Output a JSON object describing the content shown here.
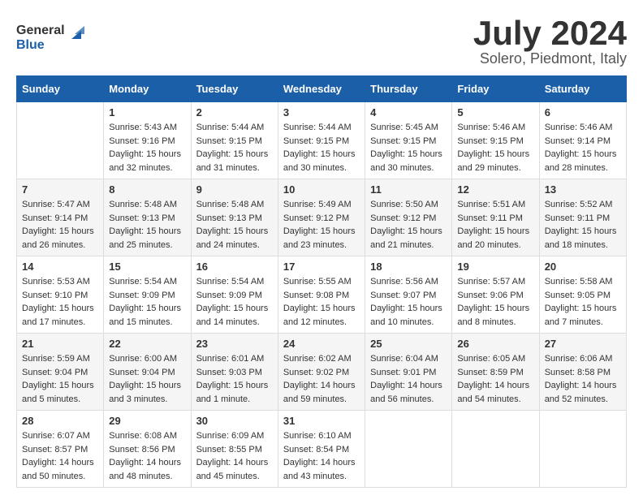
{
  "logo": {
    "text_general": "General",
    "text_blue": "Blue"
  },
  "header": {
    "month": "July 2024",
    "location": "Solero, Piedmont, Italy"
  },
  "days_of_week": [
    "Sunday",
    "Monday",
    "Tuesday",
    "Wednesday",
    "Thursday",
    "Friday",
    "Saturday"
  ],
  "weeks": [
    [
      {
        "day": "",
        "sunrise": "",
        "sunset": "",
        "daylight": ""
      },
      {
        "day": "1",
        "sunrise": "Sunrise: 5:43 AM",
        "sunset": "Sunset: 9:16 PM",
        "daylight": "Daylight: 15 hours and 32 minutes."
      },
      {
        "day": "2",
        "sunrise": "Sunrise: 5:44 AM",
        "sunset": "Sunset: 9:15 PM",
        "daylight": "Daylight: 15 hours and 31 minutes."
      },
      {
        "day": "3",
        "sunrise": "Sunrise: 5:44 AM",
        "sunset": "Sunset: 9:15 PM",
        "daylight": "Daylight: 15 hours and 30 minutes."
      },
      {
        "day": "4",
        "sunrise": "Sunrise: 5:45 AM",
        "sunset": "Sunset: 9:15 PM",
        "daylight": "Daylight: 15 hours and 30 minutes."
      },
      {
        "day": "5",
        "sunrise": "Sunrise: 5:46 AM",
        "sunset": "Sunset: 9:15 PM",
        "daylight": "Daylight: 15 hours and 29 minutes."
      },
      {
        "day": "6",
        "sunrise": "Sunrise: 5:46 AM",
        "sunset": "Sunset: 9:14 PM",
        "daylight": "Daylight: 15 hours and 28 minutes."
      }
    ],
    [
      {
        "day": "7",
        "sunrise": "Sunrise: 5:47 AM",
        "sunset": "Sunset: 9:14 PM",
        "daylight": "Daylight: 15 hours and 26 minutes."
      },
      {
        "day": "8",
        "sunrise": "Sunrise: 5:48 AM",
        "sunset": "Sunset: 9:13 PM",
        "daylight": "Daylight: 15 hours and 25 minutes."
      },
      {
        "day": "9",
        "sunrise": "Sunrise: 5:48 AM",
        "sunset": "Sunset: 9:13 PM",
        "daylight": "Daylight: 15 hours and 24 minutes."
      },
      {
        "day": "10",
        "sunrise": "Sunrise: 5:49 AM",
        "sunset": "Sunset: 9:12 PM",
        "daylight": "Daylight: 15 hours and 23 minutes."
      },
      {
        "day": "11",
        "sunrise": "Sunrise: 5:50 AM",
        "sunset": "Sunset: 9:12 PM",
        "daylight": "Daylight: 15 hours and 21 minutes."
      },
      {
        "day": "12",
        "sunrise": "Sunrise: 5:51 AM",
        "sunset": "Sunset: 9:11 PM",
        "daylight": "Daylight: 15 hours and 20 minutes."
      },
      {
        "day": "13",
        "sunrise": "Sunrise: 5:52 AM",
        "sunset": "Sunset: 9:11 PM",
        "daylight": "Daylight: 15 hours and 18 minutes."
      }
    ],
    [
      {
        "day": "14",
        "sunrise": "Sunrise: 5:53 AM",
        "sunset": "Sunset: 9:10 PM",
        "daylight": "Daylight: 15 hours and 17 minutes."
      },
      {
        "day": "15",
        "sunrise": "Sunrise: 5:54 AM",
        "sunset": "Sunset: 9:09 PM",
        "daylight": "Daylight: 15 hours and 15 minutes."
      },
      {
        "day": "16",
        "sunrise": "Sunrise: 5:54 AM",
        "sunset": "Sunset: 9:09 PM",
        "daylight": "Daylight: 15 hours and 14 minutes."
      },
      {
        "day": "17",
        "sunrise": "Sunrise: 5:55 AM",
        "sunset": "Sunset: 9:08 PM",
        "daylight": "Daylight: 15 hours and 12 minutes."
      },
      {
        "day": "18",
        "sunrise": "Sunrise: 5:56 AM",
        "sunset": "Sunset: 9:07 PM",
        "daylight": "Daylight: 15 hours and 10 minutes."
      },
      {
        "day": "19",
        "sunrise": "Sunrise: 5:57 AM",
        "sunset": "Sunset: 9:06 PM",
        "daylight": "Daylight: 15 hours and 8 minutes."
      },
      {
        "day": "20",
        "sunrise": "Sunrise: 5:58 AM",
        "sunset": "Sunset: 9:05 PM",
        "daylight": "Daylight: 15 hours and 7 minutes."
      }
    ],
    [
      {
        "day": "21",
        "sunrise": "Sunrise: 5:59 AM",
        "sunset": "Sunset: 9:04 PM",
        "daylight": "Daylight: 15 hours and 5 minutes."
      },
      {
        "day": "22",
        "sunrise": "Sunrise: 6:00 AM",
        "sunset": "Sunset: 9:04 PM",
        "daylight": "Daylight: 15 hours and 3 minutes."
      },
      {
        "day": "23",
        "sunrise": "Sunrise: 6:01 AM",
        "sunset": "Sunset: 9:03 PM",
        "daylight": "Daylight: 15 hours and 1 minute."
      },
      {
        "day": "24",
        "sunrise": "Sunrise: 6:02 AM",
        "sunset": "Sunset: 9:02 PM",
        "daylight": "Daylight: 14 hours and 59 minutes."
      },
      {
        "day": "25",
        "sunrise": "Sunrise: 6:04 AM",
        "sunset": "Sunset: 9:01 PM",
        "daylight": "Daylight: 14 hours and 56 minutes."
      },
      {
        "day": "26",
        "sunrise": "Sunrise: 6:05 AM",
        "sunset": "Sunset: 8:59 PM",
        "daylight": "Daylight: 14 hours and 54 minutes."
      },
      {
        "day": "27",
        "sunrise": "Sunrise: 6:06 AM",
        "sunset": "Sunset: 8:58 PM",
        "daylight": "Daylight: 14 hours and 52 minutes."
      }
    ],
    [
      {
        "day": "28",
        "sunrise": "Sunrise: 6:07 AM",
        "sunset": "Sunset: 8:57 PM",
        "daylight": "Daylight: 14 hours and 50 minutes."
      },
      {
        "day": "29",
        "sunrise": "Sunrise: 6:08 AM",
        "sunset": "Sunset: 8:56 PM",
        "daylight": "Daylight: 14 hours and 48 minutes."
      },
      {
        "day": "30",
        "sunrise": "Sunrise: 6:09 AM",
        "sunset": "Sunset: 8:55 PM",
        "daylight": "Daylight: 14 hours and 45 minutes."
      },
      {
        "day": "31",
        "sunrise": "Sunrise: 6:10 AM",
        "sunset": "Sunset: 8:54 PM",
        "daylight": "Daylight: 14 hours and 43 minutes."
      },
      {
        "day": "",
        "sunrise": "",
        "sunset": "",
        "daylight": ""
      },
      {
        "day": "",
        "sunrise": "",
        "sunset": "",
        "daylight": ""
      },
      {
        "day": "",
        "sunrise": "",
        "sunset": "",
        "daylight": ""
      }
    ]
  ]
}
